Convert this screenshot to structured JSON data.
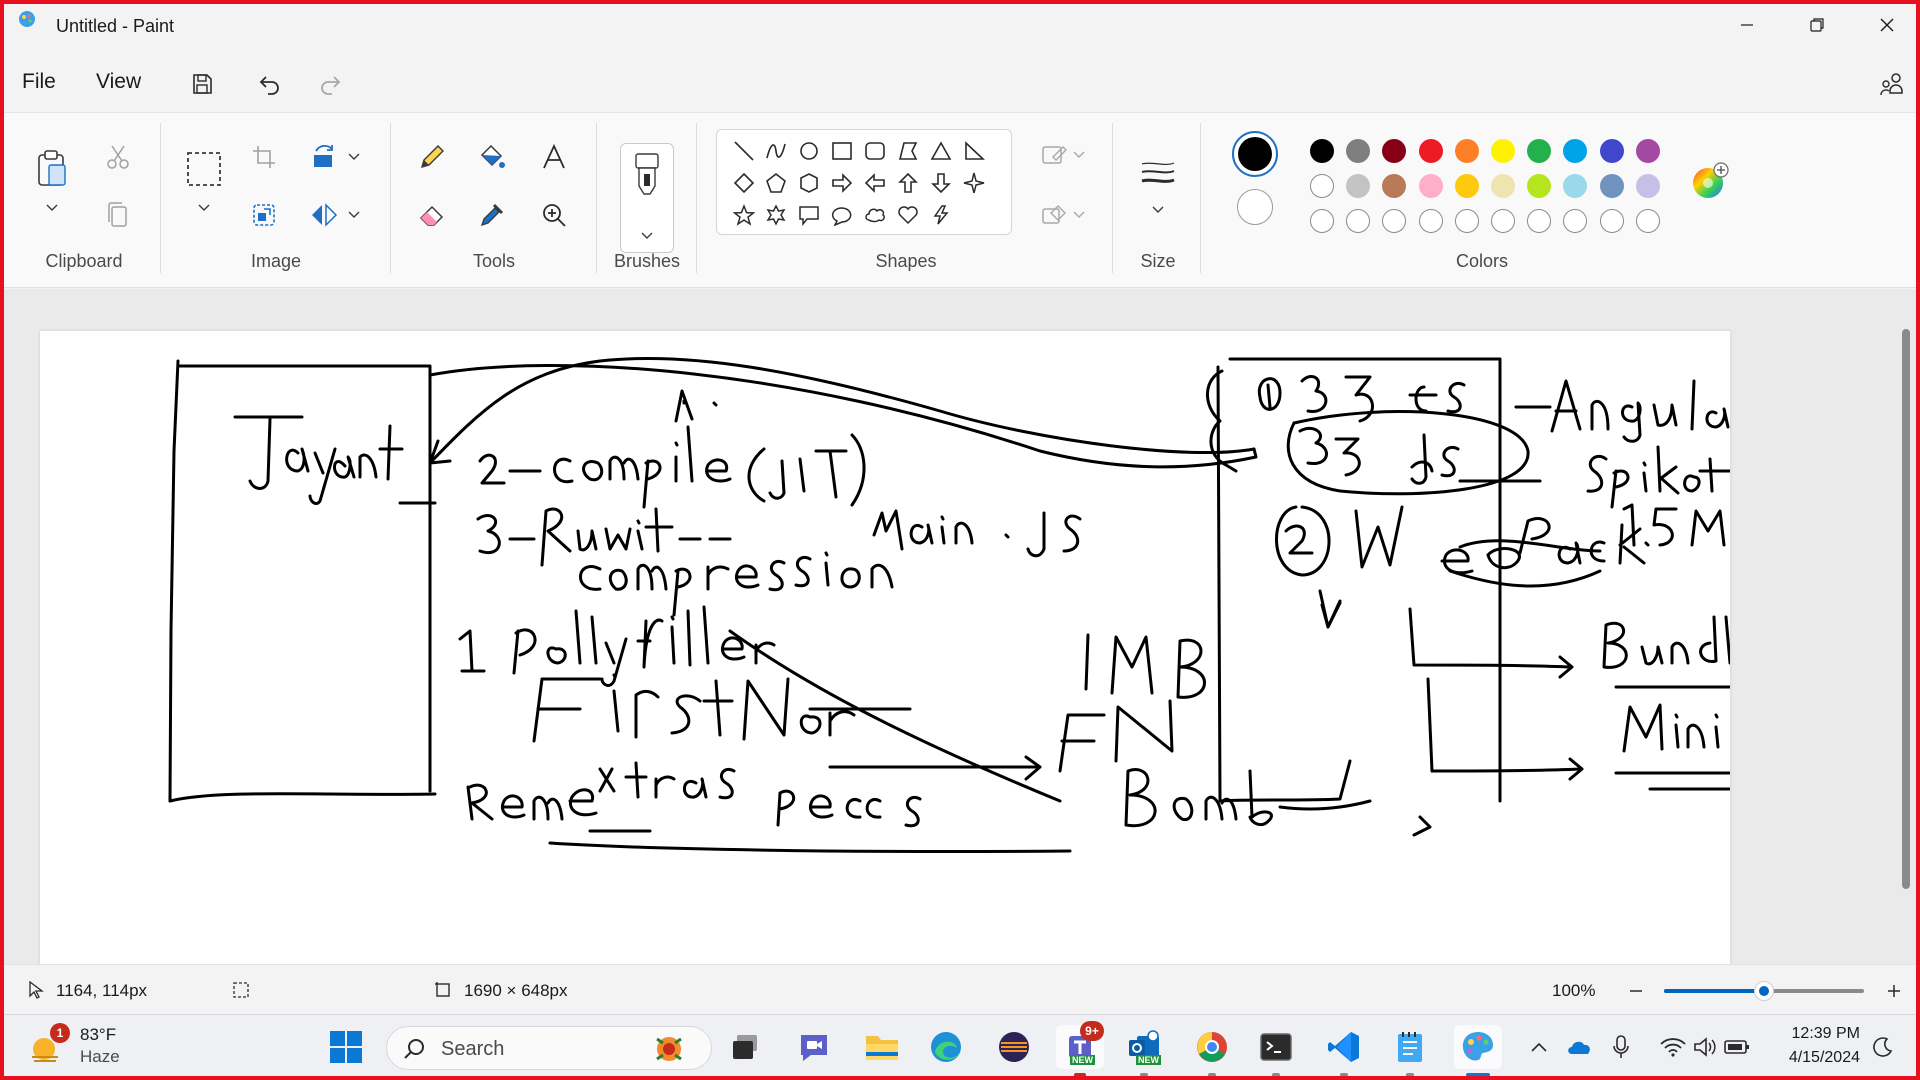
{
  "window": {
    "title": "Untitled - Paint"
  },
  "menu": {
    "file": "File",
    "view": "View"
  },
  "ribbon": {
    "groups": {
      "clipboard": "Clipboard",
      "image": "Image",
      "tools": "Tools",
      "brushes": "Brushes",
      "shapes": "Shapes",
      "size": "Size",
      "colors": "Colors"
    },
    "primary_color": "#000000",
    "secondary_color": "#ffffff",
    "palette_row1": [
      "#000000",
      "#7f7f7f",
      "#880015",
      "#ed1c24",
      "#ff7f27",
      "#fff200",
      "#22b14c",
      "#00a2e8",
      "#3f48cc",
      "#a349a4"
    ],
    "palette_row2": [
      "#ffffff",
      "#c3c3c3",
      "#b97a57",
      "#ffaec9",
      "#ffc90e",
      "#efe4b0",
      "#b5e61d",
      "#99d9ea",
      "#7092be",
      "#c8bfe7"
    ]
  },
  "status": {
    "cursor_position": "1164, 114px",
    "canvas_size": "1690 × 648px",
    "zoom_label": "100%",
    "zoom_level": 0.5
  },
  "taskbar": {
    "weather_temp": "83°F",
    "weather_desc": "Haze",
    "weather_badge": "1",
    "search_placeholder": "Search",
    "teams_badge": "9+",
    "teams_new": "NEW",
    "outlook_new": "NEW",
    "time": "12:39 PM",
    "date": "4/15/2024"
  }
}
